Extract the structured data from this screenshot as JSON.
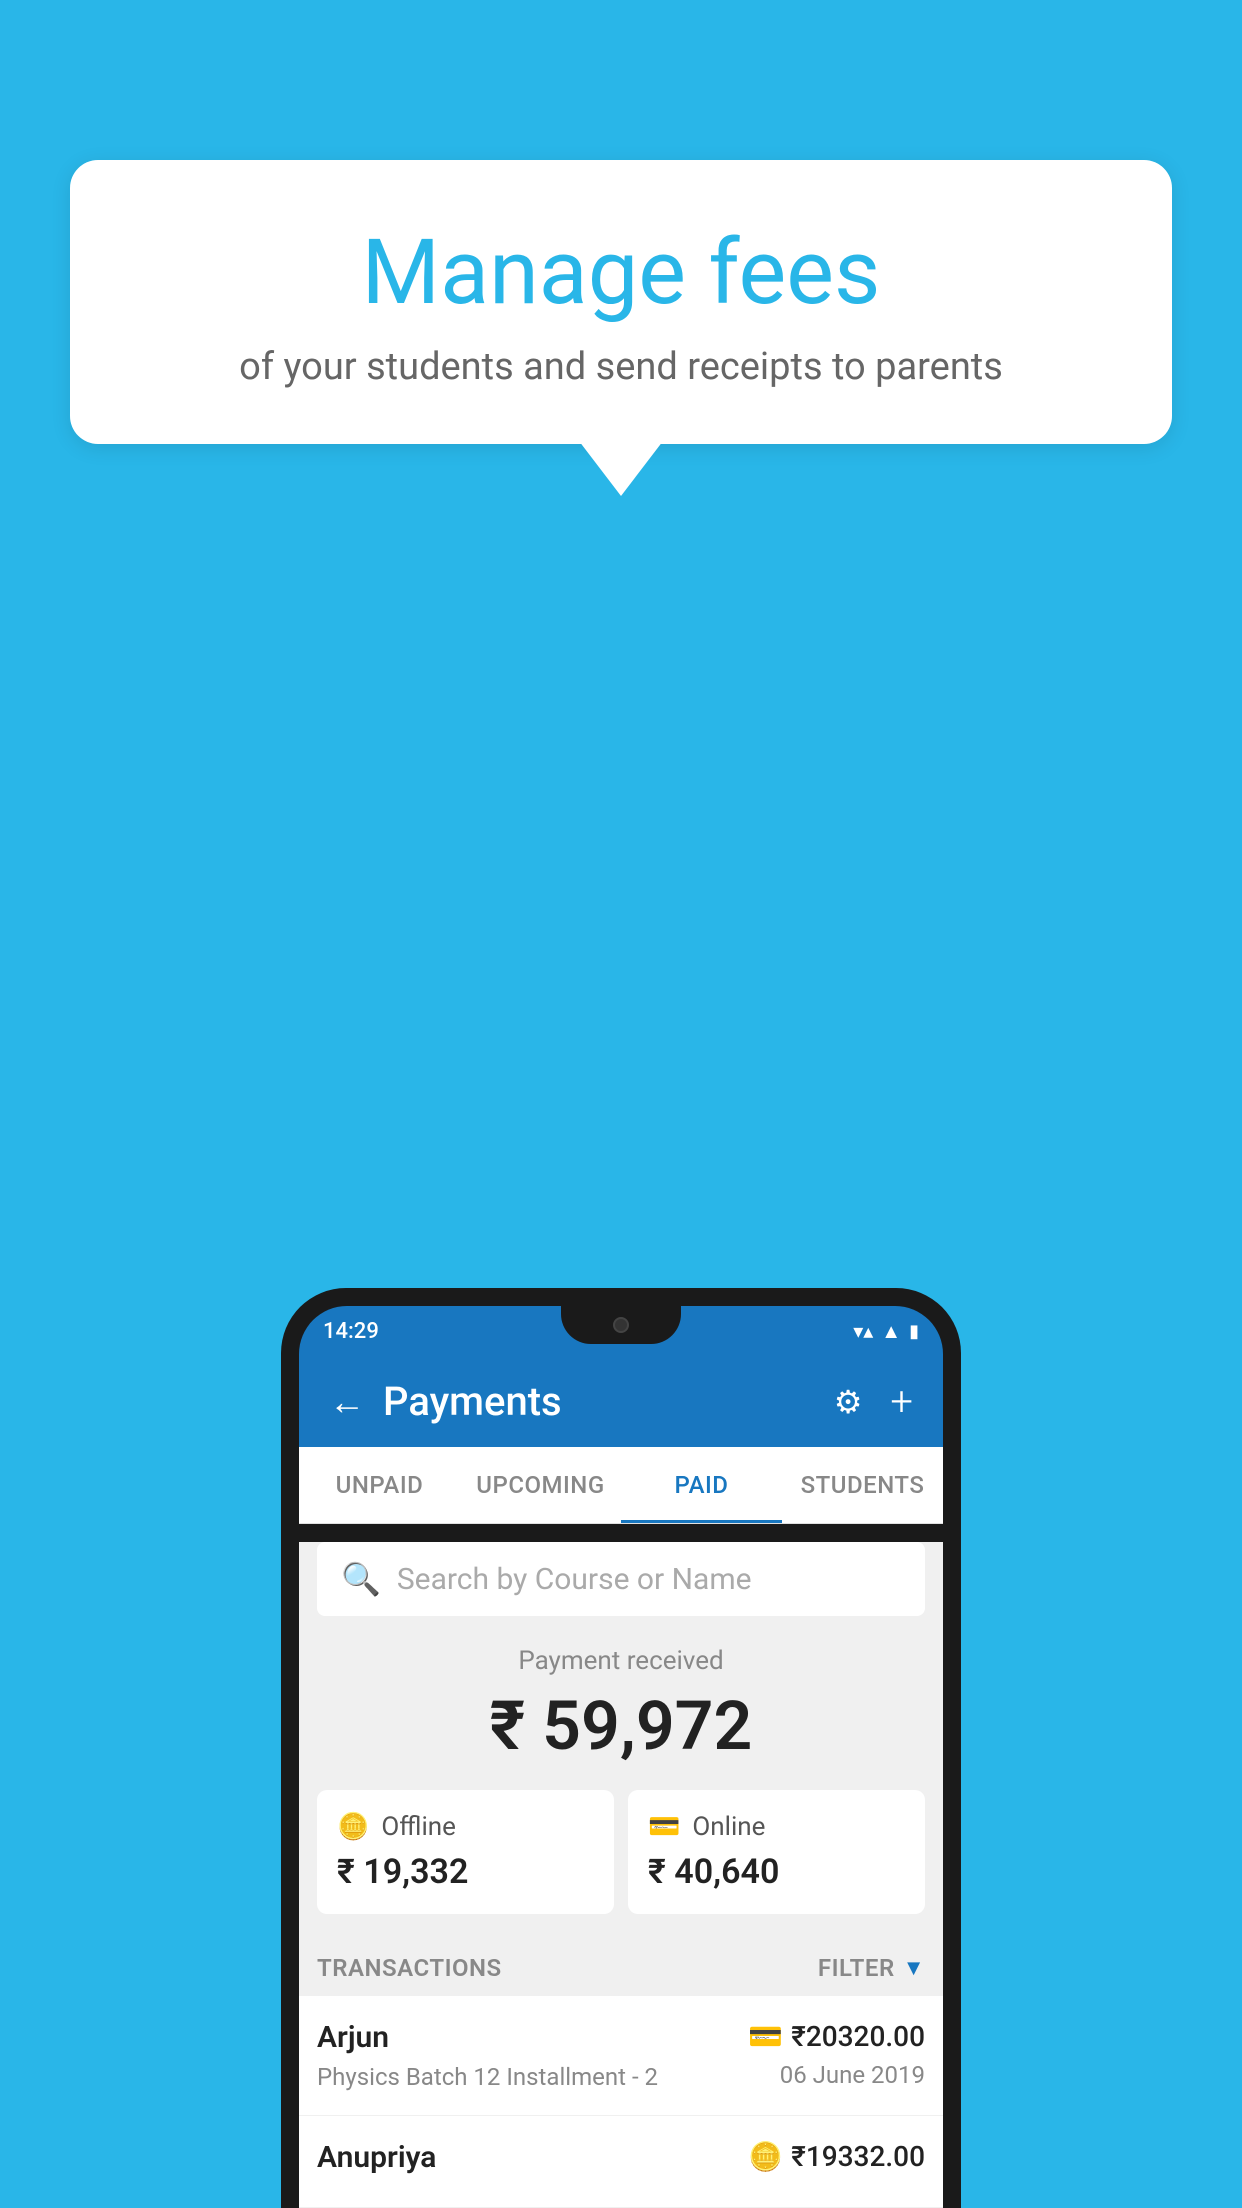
{
  "page": {
    "background_color": "#29b6e8"
  },
  "speech_bubble": {
    "title": "Manage fees",
    "subtitle": "of your students and send receipts to parents"
  },
  "phone": {
    "status_bar": {
      "time": "14:29",
      "wifi": "▼",
      "signal": "▲",
      "battery": "▮"
    },
    "header": {
      "back_label": "←",
      "title": "Payments",
      "settings_label": "⚙",
      "add_label": "+"
    },
    "tabs": [
      {
        "label": "UNPAID",
        "active": false
      },
      {
        "label": "UPCOMING",
        "active": false
      },
      {
        "label": "PAID",
        "active": true
      },
      {
        "label": "STUDENTS",
        "active": false
      }
    ],
    "search": {
      "placeholder": "Search by Course or Name"
    },
    "payment_summary": {
      "label": "Payment received",
      "amount": "₹ 59,972"
    },
    "payment_cards": [
      {
        "type": "Offline",
        "amount": "₹ 19,332",
        "icon": "💳"
      },
      {
        "type": "Online",
        "amount": "₹ 40,640",
        "icon": "💳"
      }
    ],
    "transactions_label": "TRANSACTIONS",
    "filter_label": "FILTER",
    "transactions": [
      {
        "name": "Arjun",
        "detail": "Physics Batch 12 Installment - 2",
        "amount": "₹20320.00",
        "date": "06 June 2019",
        "payment_type": "card"
      },
      {
        "name": "Anupriya",
        "detail": "",
        "amount": "₹19332.00",
        "date": "",
        "payment_type": "offline"
      }
    ]
  }
}
